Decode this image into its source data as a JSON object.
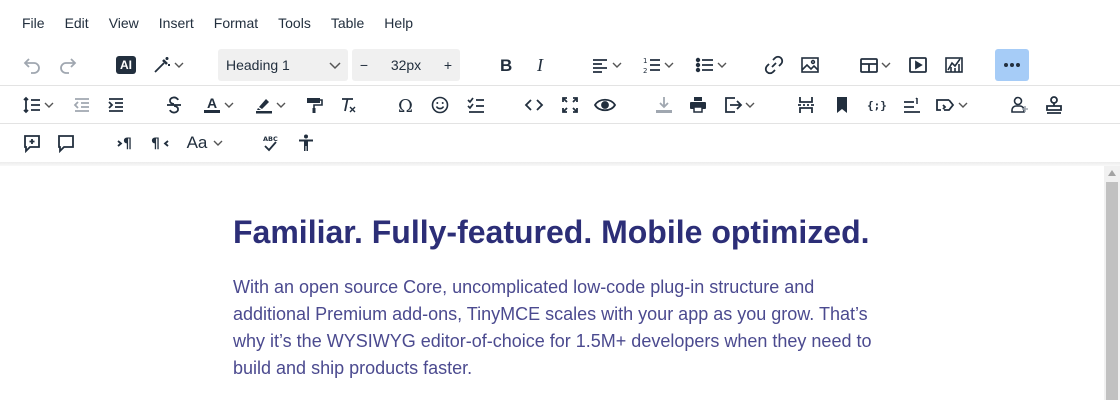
{
  "menubar": {
    "items": [
      "File",
      "Edit",
      "View",
      "Insert",
      "Format",
      "Tools",
      "Table",
      "Help"
    ]
  },
  "toolbar": {
    "ai_label": "AI",
    "block_format": "Heading 1",
    "font_size": "32px",
    "font_size_minus": "−",
    "font_size_plus": "+",
    "case_label": "Aa",
    "spellcheck_label": "ABC",
    "template_label": "{;}",
    "more_active_color": "#a6ccf7"
  },
  "content": {
    "heading": "Familiar. Fully-featured. Mobile optimized.",
    "paragraph": "With an open source Core, uncomplicated low-code plug-in structure and additional Premium add-ons, TinyMCE scales with your app as you grow. That’s why it’s the WYSIWYG editor-of-choice for 1.5M+ developers when they need to build and ship products faster.",
    "heading_color": "#2c2e77",
    "text_color": "#4b4a8f"
  }
}
